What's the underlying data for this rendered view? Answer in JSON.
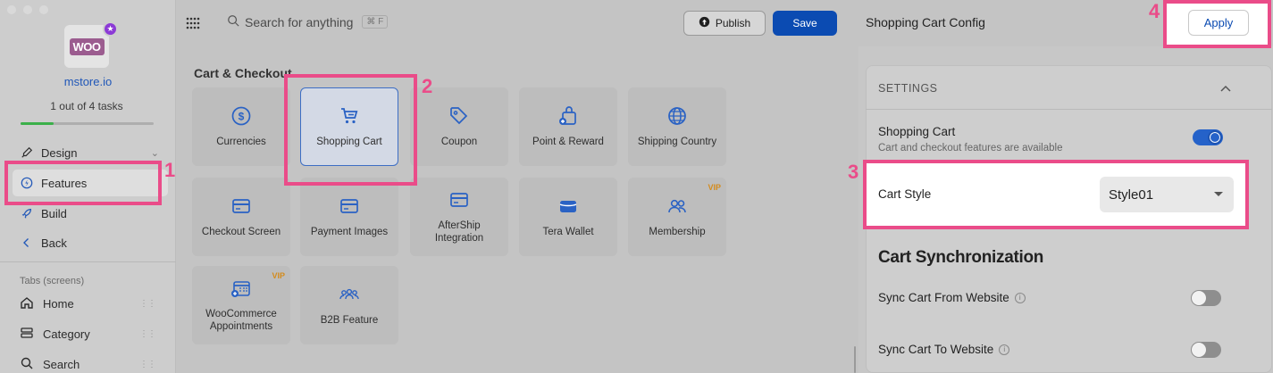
{
  "sidebar": {
    "store_name": "mstore.io",
    "logo_text": "WOO",
    "tasks_text": "1 out of 4 tasks",
    "progress": 0.25,
    "nav": [
      {
        "label": "Design",
        "icon": "brush-icon"
      },
      {
        "label": "Features",
        "icon": "bolt-icon"
      },
      {
        "label": "Build",
        "icon": "rocket-icon"
      },
      {
        "label": "Back",
        "icon": "chevron-left-icon"
      }
    ],
    "tabs_label": "Tabs (screens)",
    "tabs": [
      {
        "label": "Home",
        "icon": "home-icon"
      },
      {
        "label": "Category",
        "icon": "list-icon"
      },
      {
        "label": "Search",
        "icon": "search-icon"
      }
    ]
  },
  "topbar": {
    "search_placeholder": "Search for anything",
    "shortcut": "⌘ F",
    "publish_label": "Publish",
    "save_label": "Save"
  },
  "features": {
    "section_title": "Cart & Checkout",
    "cards": [
      {
        "label": "Currencies",
        "icon": "dollar-icon",
        "vip": ""
      },
      {
        "label": "Shopping Cart",
        "icon": "cart-icon",
        "vip": "",
        "selected": true
      },
      {
        "label": "Coupon",
        "icon": "tag-icon",
        "vip": ""
      },
      {
        "label": "Point & Reward",
        "icon": "gift-bag-icon",
        "vip": ""
      },
      {
        "label": "Shipping Country",
        "icon": "globe-icon",
        "vip": ""
      },
      {
        "label": "Checkout Screen",
        "icon": "credit-card-icon",
        "vip": ""
      },
      {
        "label": "Payment Images",
        "icon": "credit-card-icon",
        "vip": ""
      },
      {
        "label": "AfterShip Integration",
        "icon": "credit-card-icon",
        "vip": ""
      },
      {
        "label": "Tera Wallet",
        "icon": "wallet-icon",
        "vip": ""
      },
      {
        "label": "Membership",
        "icon": "users-icon",
        "vip": "VIP"
      },
      {
        "label": "WooCommerce Appointments",
        "icon": "calendar-icon",
        "vip": "VIP"
      },
      {
        "label": "B2B Feature",
        "icon": "group-icon",
        "vip": ""
      }
    ]
  },
  "panel": {
    "title": "Shopping Cart Config",
    "apply_label": "Apply",
    "settings_label": "SETTINGS",
    "shopping_cart": {
      "title": "Shopping Cart",
      "subtitle": "Cart and checkout features are available",
      "enabled": true
    },
    "cart_style": {
      "label": "Cart Style",
      "value": "Style01"
    },
    "sync_title": "Cart Synchronization",
    "sync_from": {
      "label": "Sync Cart From Website",
      "enabled": false
    },
    "sync_to": {
      "label": "Sync Cart To Website",
      "enabled": false
    }
  },
  "annotations": {
    "n1": "1",
    "n2": "2",
    "n3": "3",
    "n4": "4",
    "highlight_color": "#ea4c89"
  }
}
